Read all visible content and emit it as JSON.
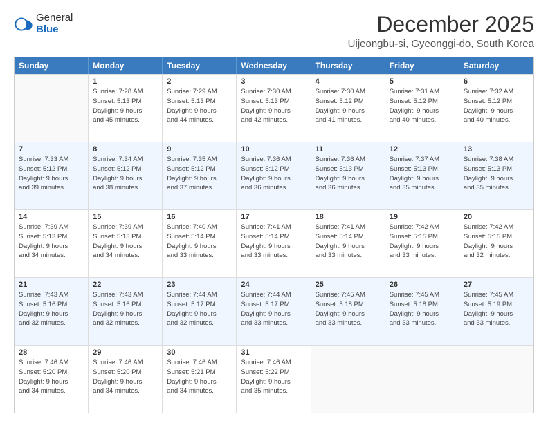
{
  "logo": {
    "general": "General",
    "blue": "Blue"
  },
  "title": "December 2025",
  "subtitle": "Uijeongbu-si, Gyeonggi-do, South Korea",
  "days": [
    "Sunday",
    "Monday",
    "Tuesday",
    "Wednesday",
    "Thursday",
    "Friday",
    "Saturday"
  ],
  "weeks": [
    [
      {
        "day": "",
        "info": ""
      },
      {
        "day": "1",
        "info": "Sunrise: 7:28 AM\nSunset: 5:13 PM\nDaylight: 9 hours\nand 45 minutes."
      },
      {
        "day": "2",
        "info": "Sunrise: 7:29 AM\nSunset: 5:13 PM\nDaylight: 9 hours\nand 44 minutes."
      },
      {
        "day": "3",
        "info": "Sunrise: 7:30 AM\nSunset: 5:13 PM\nDaylight: 9 hours\nand 42 minutes."
      },
      {
        "day": "4",
        "info": "Sunrise: 7:30 AM\nSunset: 5:12 PM\nDaylight: 9 hours\nand 41 minutes."
      },
      {
        "day": "5",
        "info": "Sunrise: 7:31 AM\nSunset: 5:12 PM\nDaylight: 9 hours\nand 40 minutes."
      },
      {
        "day": "6",
        "info": "Sunrise: 7:32 AM\nSunset: 5:12 PM\nDaylight: 9 hours\nand 40 minutes."
      }
    ],
    [
      {
        "day": "7",
        "info": "Sunrise: 7:33 AM\nSunset: 5:12 PM\nDaylight: 9 hours\nand 39 minutes."
      },
      {
        "day": "8",
        "info": "Sunrise: 7:34 AM\nSunset: 5:12 PM\nDaylight: 9 hours\nand 38 minutes."
      },
      {
        "day": "9",
        "info": "Sunrise: 7:35 AM\nSunset: 5:12 PM\nDaylight: 9 hours\nand 37 minutes."
      },
      {
        "day": "10",
        "info": "Sunrise: 7:36 AM\nSunset: 5:12 PM\nDaylight: 9 hours\nand 36 minutes."
      },
      {
        "day": "11",
        "info": "Sunrise: 7:36 AM\nSunset: 5:13 PM\nDaylight: 9 hours\nand 36 minutes."
      },
      {
        "day": "12",
        "info": "Sunrise: 7:37 AM\nSunset: 5:13 PM\nDaylight: 9 hours\nand 35 minutes."
      },
      {
        "day": "13",
        "info": "Sunrise: 7:38 AM\nSunset: 5:13 PM\nDaylight: 9 hours\nand 35 minutes."
      }
    ],
    [
      {
        "day": "14",
        "info": "Sunrise: 7:39 AM\nSunset: 5:13 PM\nDaylight: 9 hours\nand 34 minutes."
      },
      {
        "day": "15",
        "info": "Sunrise: 7:39 AM\nSunset: 5:13 PM\nDaylight: 9 hours\nand 34 minutes."
      },
      {
        "day": "16",
        "info": "Sunrise: 7:40 AM\nSunset: 5:14 PM\nDaylight: 9 hours\nand 33 minutes."
      },
      {
        "day": "17",
        "info": "Sunrise: 7:41 AM\nSunset: 5:14 PM\nDaylight: 9 hours\nand 33 minutes."
      },
      {
        "day": "18",
        "info": "Sunrise: 7:41 AM\nSunset: 5:14 PM\nDaylight: 9 hours\nand 33 minutes."
      },
      {
        "day": "19",
        "info": "Sunrise: 7:42 AM\nSunset: 5:15 PM\nDaylight: 9 hours\nand 33 minutes."
      },
      {
        "day": "20",
        "info": "Sunrise: 7:42 AM\nSunset: 5:15 PM\nDaylight: 9 hours\nand 32 minutes."
      }
    ],
    [
      {
        "day": "21",
        "info": "Sunrise: 7:43 AM\nSunset: 5:16 PM\nDaylight: 9 hours\nand 32 minutes."
      },
      {
        "day": "22",
        "info": "Sunrise: 7:43 AM\nSunset: 5:16 PM\nDaylight: 9 hours\nand 32 minutes."
      },
      {
        "day": "23",
        "info": "Sunrise: 7:44 AM\nSunset: 5:17 PM\nDaylight: 9 hours\nand 32 minutes."
      },
      {
        "day": "24",
        "info": "Sunrise: 7:44 AM\nSunset: 5:17 PM\nDaylight: 9 hours\nand 33 minutes."
      },
      {
        "day": "25",
        "info": "Sunrise: 7:45 AM\nSunset: 5:18 PM\nDaylight: 9 hours\nand 33 minutes."
      },
      {
        "day": "26",
        "info": "Sunrise: 7:45 AM\nSunset: 5:18 PM\nDaylight: 9 hours\nand 33 minutes."
      },
      {
        "day": "27",
        "info": "Sunrise: 7:45 AM\nSunset: 5:19 PM\nDaylight: 9 hours\nand 33 minutes."
      }
    ],
    [
      {
        "day": "28",
        "info": "Sunrise: 7:46 AM\nSunset: 5:20 PM\nDaylight: 9 hours\nand 34 minutes."
      },
      {
        "day": "29",
        "info": "Sunrise: 7:46 AM\nSunset: 5:20 PM\nDaylight: 9 hours\nand 34 minutes."
      },
      {
        "day": "30",
        "info": "Sunrise: 7:46 AM\nSunset: 5:21 PM\nDaylight: 9 hours\nand 34 minutes."
      },
      {
        "day": "31",
        "info": "Sunrise: 7:46 AM\nSunset: 5:22 PM\nDaylight: 9 hours\nand 35 minutes."
      },
      {
        "day": "",
        "info": ""
      },
      {
        "day": "",
        "info": ""
      },
      {
        "day": "",
        "info": ""
      }
    ]
  ]
}
